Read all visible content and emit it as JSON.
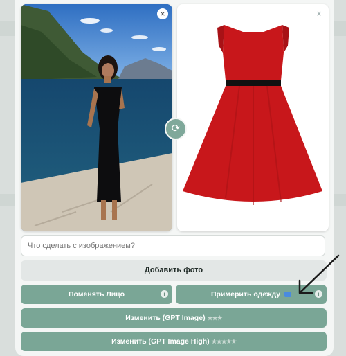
{
  "prompt": {
    "placeholder": "Что сделать с изображением?"
  },
  "add_photo_label": "Добавить фото",
  "buttons": {
    "change_face": "Поменять Лицо",
    "try_on": "Примерить одежду",
    "edit_gpt": "Изменить (GPT Image)",
    "edit_gpt_stars": "★★★",
    "edit_gpt_high": "Изменить (GPT Image High)",
    "edit_gpt_high_stars": "★★★★★"
  },
  "icons": {
    "close": "×",
    "swap": "⟳",
    "info": "i"
  },
  "colors": {
    "accent": "#7aa696",
    "dress": "#c8171b"
  }
}
